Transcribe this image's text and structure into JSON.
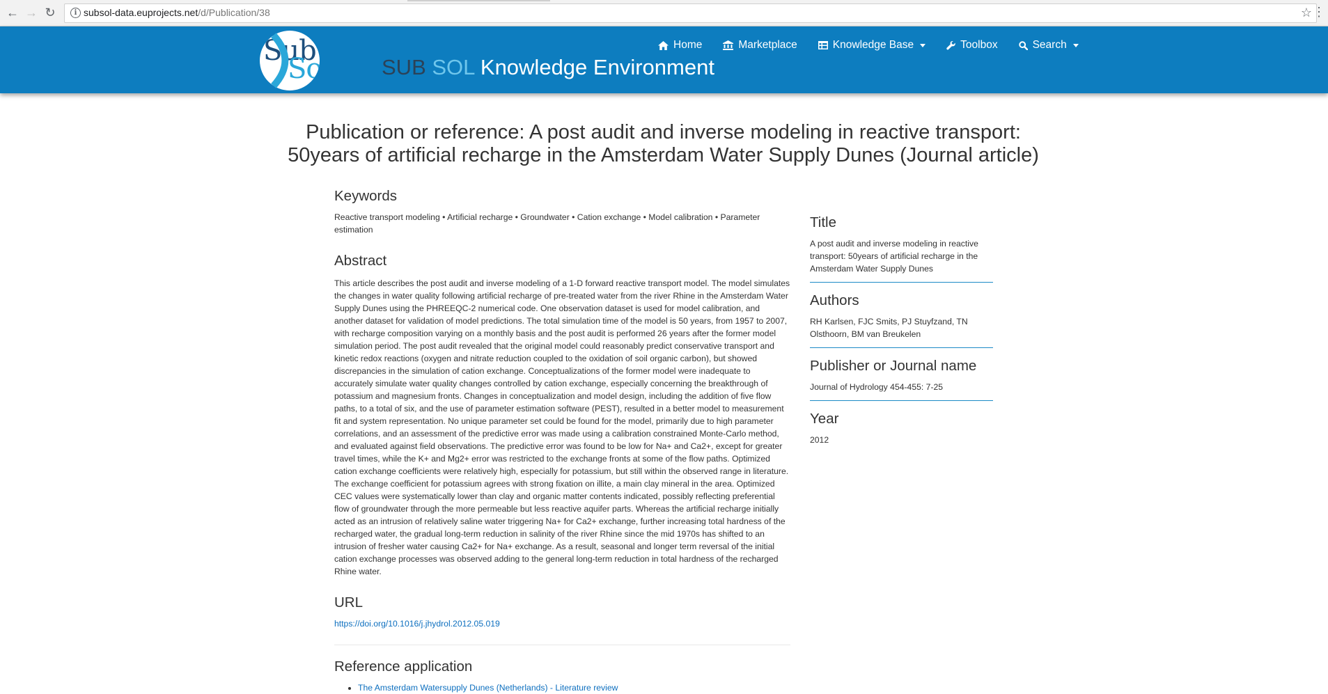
{
  "browser": {
    "url_host": "subsol-data.euprojects.net",
    "url_path": "/d/Publication/38"
  },
  "site": {
    "logo": {
      "line1": "Sub",
      "line2": "Sol"
    },
    "title_part1": "SUB",
    "title_part2": "SOL",
    "title_part3": "Knowledge Environment",
    "nav": [
      {
        "label": "Home",
        "icon": "home-icon"
      },
      {
        "label": "Marketplace",
        "icon": "bank-icon"
      },
      {
        "label": "Knowledge Base",
        "icon": "table-icon",
        "dropdown": true
      },
      {
        "label": "Toolbox",
        "icon": "wrench-icon"
      },
      {
        "label": "Search",
        "icon": "search-icon",
        "dropdown": true
      }
    ]
  },
  "page": {
    "title_line1": "Publication or reference: A post audit and inverse modeling in reactive transport:",
    "title_line2": "50years of artificial recharge in the Amsterdam Water Supply Dunes (Journal article)",
    "keywords_heading": "Keywords",
    "keywords": "Reactive transport modeling • Artificial recharge • Groundwater • Cation exchange • Model calibration • Parameter estimation",
    "abstract_heading": "Abstract",
    "abstract": "This article describes the post audit and inverse modeling of a 1-D forward reactive transport model. The model simulates the changes in water quality following artificial recharge of pre-treated water from the river Rhine in the Amsterdam Water Supply Dunes using the PHREEQC-2 numerical code. One observation dataset is used for model calibration, and another dataset for validation of model predictions. The total simulation time of the model is 50 years, from 1957 to 2007, with recharge composition varying on a monthly basis and the post audit is performed 26 years after the former model simulation period. The post audit revealed that the original model could reasonably predict conservative transport and kinetic redox reactions (oxygen and nitrate reduction coupled to the oxidation of soil organic carbon), but showed discrepancies in the simulation of cation exchange. Conceptualizations of the former model were inadequate to accurately simulate water quality changes controlled by cation exchange, especially concerning the breakthrough of potassium and magnesium fronts. Changes in conceptualization and model design, including the addition of five flow paths, to a total of six, and the use of parameter estimation software (PEST), resulted in a better model to measurement fit and system representation. No unique parameter set could be found for the model, primarily due to high parameter correlations, and an assessment of the predictive error was made using a calibration constrained Monte-Carlo method, and evaluated against field observations. The predictive error was found to be low for Na+ and Ca2+, except for greater travel times, while the K+ and Mg2+ error was restricted to the exchange fronts at some of the flow paths. Optimized cation exchange coefficients were relatively high, especially for potassium, but still within the observed range in literature. The exchange coefficient for potassium agrees with strong fixation on illite, a main clay mineral in the area. Optimized CEC values were systematically lower than clay and organic matter contents indicated, possibly reflecting preferential flow of groundwater through the more permeable but less reactive aquifer parts. Whereas the artificial recharge initially acted as an intrusion of relatively saline water triggering Na+ for Ca2+ exchange, further increasing total hardness of the recharged water, the gradual long-term reduction in salinity of the river Rhine since the mid 1970s has shifted to an intrusion of fresher water causing Ca2+ for Na+ exchange. As a result, seasonal and longer term reversal of the initial cation exchange processes was observed adding to the general long-term reduction in total hardness of the recharged Rhine water.",
    "url_heading": "URL",
    "url": "https://doi.org/10.1016/j.jhydrol.2012.05.019",
    "reference_heading": "Reference application",
    "references": [
      "The Amsterdam Watersupply Dunes (Netherlands) - Literature review"
    ]
  },
  "sidebar": {
    "title_heading": "Title",
    "title": "A post audit and inverse modeling in reactive transport: 50years of artificial recharge in the Amsterdam Water Supply Dunes",
    "authors_heading": "Authors",
    "authors": "RH Karlsen, FJC Smits, PJ Stuyfzand, TN Olsthoorn, BM van Breukelen",
    "publisher_heading": "Publisher or Journal name",
    "publisher": "Journal of Hydrology 454-455: 7-25",
    "year_heading": "Year",
    "year": "2012"
  },
  "colors": {
    "header": "#0d7dbf",
    "link": "#0d6fbf",
    "divider": "#1b8ac6"
  }
}
